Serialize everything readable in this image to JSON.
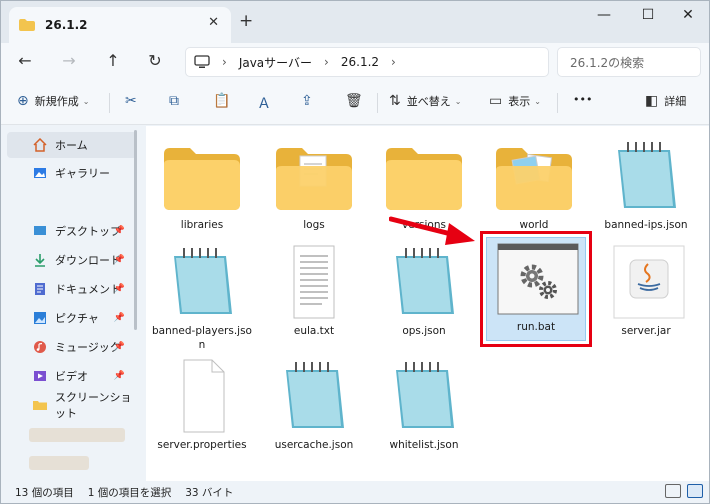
{
  "window": {
    "tab_title": "26.1.2",
    "new_tab": "+",
    "close_tab": "✕",
    "minimize": "—",
    "maximize": "☐",
    "close": "✕"
  },
  "address": {
    "back": "←",
    "forward": "→",
    "up": "↑",
    "refresh": "↻",
    "crumbs": [
      "Javaサーバー",
      "26.1.2"
    ],
    "search_placeholder": "26.1.2の検索"
  },
  "commands": {
    "new_label": "新規作成",
    "sort_label": "並べ替え",
    "view_label": "表示",
    "more": "•••",
    "details_label": "詳細"
  },
  "sidebar": {
    "items": [
      {
        "label": "ホーム",
        "icon": "home-icon"
      },
      {
        "label": "ギャラリー",
        "icon": "gallery-icon"
      },
      {
        "label": "デスクトップ",
        "icon": "desktop-icon",
        "pinned": true
      },
      {
        "label": "ダウンロード",
        "icon": "download-icon",
        "pinned": true
      },
      {
        "label": "ドキュメント",
        "icon": "document-icon",
        "pinned": true
      },
      {
        "label": "ピクチャ",
        "icon": "pictures-icon",
        "pinned": true
      },
      {
        "label": "ミュージック",
        "icon": "music-icon",
        "pinned": true
      },
      {
        "label": "ビデオ",
        "icon": "video-icon",
        "pinned": true
      },
      {
        "label": "スクリーンショット",
        "icon": "folder-icon",
        "pinned": false
      }
    ],
    "pin_glyph": "📌"
  },
  "files": [
    {
      "name": "libraries",
      "kind": "folder"
    },
    {
      "name": "logs",
      "kind": "folder-docs"
    },
    {
      "name": "versions",
      "kind": "folder"
    },
    {
      "name": "world",
      "kind": "folder-image"
    },
    {
      "name": "banned-ips.json",
      "kind": "notepad"
    },
    {
      "name": "banned-players.json",
      "kind": "notepad"
    },
    {
      "name": "eula.txt",
      "kind": "text"
    },
    {
      "name": "ops.json",
      "kind": "notepad"
    },
    {
      "name": "run.bat",
      "kind": "batch",
      "selected": true
    },
    {
      "name": "server.jar",
      "kind": "jar"
    },
    {
      "name": "server.properties",
      "kind": "blank"
    },
    {
      "name": "usercache.json",
      "kind": "notepad"
    },
    {
      "name": "whitelist.json",
      "kind": "notepad"
    }
  ],
  "status": {
    "count": "13 個の項目",
    "selected": "1 個の項目を選択",
    "size": "33 バイト"
  }
}
